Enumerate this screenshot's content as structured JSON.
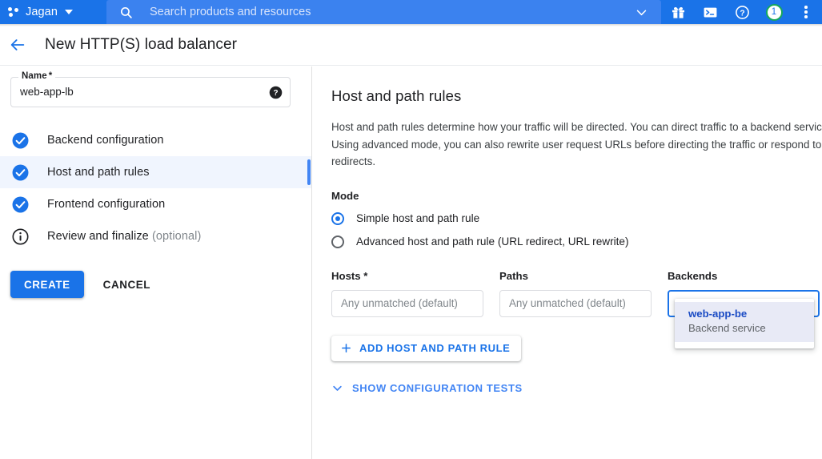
{
  "topbar": {
    "project_name": "Jagan",
    "project_caret": "chevron-down",
    "search_placeholder": "Search products and resources",
    "search_icon": "search-icon",
    "search_chevron": "chevron-down-icon",
    "actions": [
      {
        "name": "gift-icon",
        "label": ""
      },
      {
        "name": "cloud-shell-icon",
        "label": ""
      },
      {
        "name": "help-icon",
        "label": ""
      }
    ],
    "notification_count": "1",
    "kebab_icon": "more-vert-icon",
    "bar_color": "#1a73e8",
    "search_color": "#3b82ef",
    "notification_ring_color": "#17a95a"
  },
  "titlebar": {
    "back_icon": "arrow-back-icon",
    "title": "New HTTP(S) load balancer"
  },
  "sidebar": {
    "name_field": {
      "label": "Name",
      "required_mark": "*",
      "value": "web-app-lb",
      "help_icon": "help-filled-icon"
    },
    "steps": [
      {
        "label": "Backend configuration",
        "icon": "check-circle-icon",
        "state": "complete",
        "selected": false
      },
      {
        "label": "Host and path rules",
        "icon": "check-circle-icon",
        "state": "complete",
        "selected": true
      },
      {
        "label": "Frontend configuration",
        "icon": "check-circle-icon",
        "state": "complete",
        "selected": false
      },
      {
        "label": "Review and finalize",
        "optional": " (optional)",
        "icon": "info-outline-icon",
        "state": "info",
        "selected": false
      }
    ],
    "create_label": "CREATE",
    "cancel_label": "CANCEL",
    "accent_color": "#4285f4",
    "selected_bg": "#f0f5fe"
  },
  "main": {
    "heading": "Host and path rules",
    "description": "Host and path rules determine how your traffic will be directed. You can direct traffic to a backend service or a storage bucket. Using advanced mode, you can also rewrite user request URLs before directing the traffic or respond to the client with URL redirects.",
    "mode": {
      "label": "Mode",
      "options": [
        {
          "label": "Simple host and path rule",
          "selected": true
        },
        {
          "label": "Advanced host and path rule (URL redirect, URL rewrite)",
          "selected": false
        }
      ]
    },
    "fields": {
      "hosts": {
        "label": "Hosts",
        "required_mark": " *",
        "value": "",
        "placeholder": "Any unmatched (default)",
        "focused": false
      },
      "paths": {
        "label": "Paths",
        "required_mark": "",
        "value": "",
        "placeholder": "Any unmatched (default)",
        "focused": false
      },
      "backends": {
        "label": "Backends",
        "required_mark": "",
        "value": "",
        "placeholder": "",
        "focused": true
      }
    },
    "dropdown": {
      "items": [
        {
          "title": "web-app-be",
          "subtitle": "Backend service",
          "highlighted": true
        }
      ],
      "highlight_color": "#e8eaf6",
      "title_color": "#1a4bc4"
    },
    "add_rule_label": "ADD HOST AND PATH RULE",
    "add_rule_icon": "plus-icon",
    "show_tests_label": "SHOW CONFIGURATION TESTS",
    "show_tests_icon": "chevron-down-icon"
  }
}
